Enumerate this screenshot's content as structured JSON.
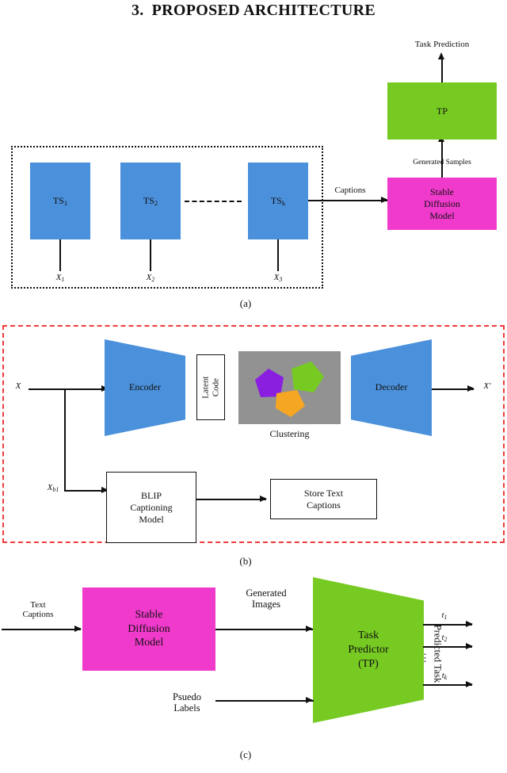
{
  "title": {
    "number": "3.",
    "text": "PROPOSED ARCHITECTURE"
  },
  "colors": {
    "blue": "#4b90da",
    "green": "#76ca22",
    "pink": "#f03acc",
    "cluster_bg": "#929292",
    "cluster_purple": "#8a1fe0",
    "cluster_green": "#76ca22",
    "cluster_orange": "#f5a623",
    "dashed_frame": "#ef3b3b",
    "stroke": "#111111"
  },
  "panel_a": {
    "caption": "(a)",
    "task_boxes": [
      {
        "label": "TS",
        "sub": "1"
      },
      {
        "label": "TS",
        "sub": "2"
      },
      {
        "label": "TS",
        "sub": "k"
      }
    ],
    "inputs": [
      {
        "label": "X",
        "sub": "1"
      },
      {
        "label": "X",
        "sub": "2"
      },
      {
        "label": "X",
        "sub": "3"
      }
    ],
    "ellipsis_connector": "dashed",
    "captions_edge_label": "Captions",
    "stable_diffusion_label": "Stable\nDiffusion\nModel",
    "generated_samples_label": "Generated Samples",
    "tp_box_label": "TP",
    "task_prediction_label": "Task Prediction"
  },
  "panel_b": {
    "caption": "(b)",
    "input_label": "X",
    "branch_label": "X",
    "branch_sub": "b1",
    "encoder_label": "Encoder",
    "latent_code_label": "Latent\nCode",
    "clustering_label": "Clustering",
    "decoder_label": "Decoder",
    "output_label": "X′",
    "blip_label": "BLIP\nCaptioning\nModel",
    "store_label": "Store Text\nCaptions"
  },
  "panel_c": {
    "caption": "(c)",
    "text_captions_label": "Text\nCaptions",
    "stable_diffusion_label": "Stable\nDiffusion\nModel",
    "generated_images_label": "Generated\nImages",
    "task_predictor_label": "Task\nPredictor\n(TP)",
    "pseudo_labels_label": "Psuedo\nLabels",
    "outputs": [
      {
        "label": "t",
        "sub": "1"
      },
      {
        "label": "t",
        "sub": "2"
      },
      {
        "label": "t",
        "sub": "k"
      }
    ],
    "output_ellipsis": "⋮",
    "predicted_task_label": "Predicted Task"
  }
}
